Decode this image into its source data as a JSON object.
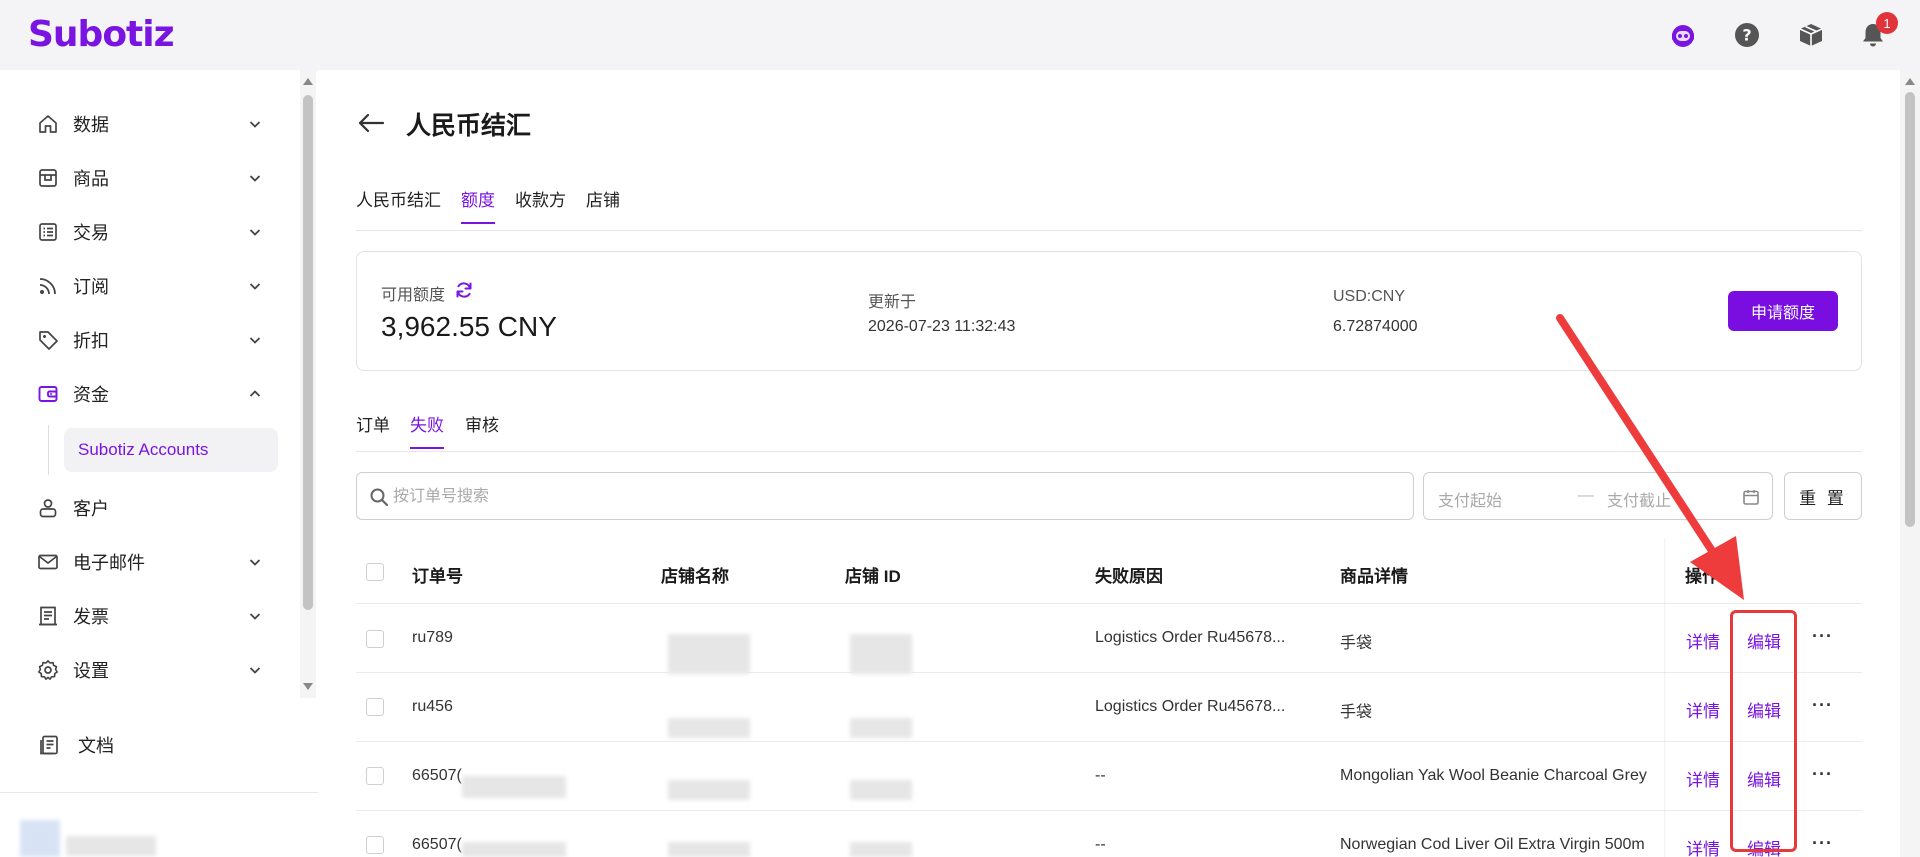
{
  "app": {
    "logo": "Subotiz",
    "notification_count": "1"
  },
  "colors": {
    "accent": "#7a14e0",
    "highlight": "#e5393a"
  },
  "sidebar": {
    "items": [
      {
        "label": "数据",
        "icon": "home-icon",
        "expanded": false
      },
      {
        "label": "商品",
        "icon": "box-icon",
        "expanded": false
      },
      {
        "label": "交易",
        "icon": "list-icon",
        "expanded": false
      },
      {
        "label": "订阅",
        "icon": "rss-icon",
        "expanded": false
      },
      {
        "label": "折扣",
        "icon": "tag-icon",
        "expanded": false
      },
      {
        "label": "资金",
        "icon": "wallet-icon",
        "expanded": true
      },
      {
        "label": "客户",
        "icon": "user-icon",
        "expanded": false
      },
      {
        "label": "电子邮件",
        "icon": "mail-icon",
        "expanded": false
      },
      {
        "label": "发票",
        "icon": "invoice-icon",
        "expanded": false
      },
      {
        "label": "设置",
        "icon": "gear-icon",
        "expanded": false
      }
    ],
    "sub_item": "Subotiz Accounts",
    "docs": "文档"
  },
  "page": {
    "title": "人民币结汇",
    "tabs": [
      "人民币结汇",
      "额度",
      "收款方",
      "店铺"
    ],
    "active_tab": "额度"
  },
  "quota": {
    "available_label": "可用额度",
    "available_value": "3,962.55 CNY",
    "updated_label": "更新于",
    "updated_value": "2026-07-23 11:32:43",
    "rate_label": "USD:CNY",
    "rate_value": "6.72874000",
    "apply_button": "申请额度"
  },
  "subtabs": {
    "items": [
      "订单",
      "失败",
      "审核"
    ],
    "active": "失败"
  },
  "filters": {
    "search_placeholder": "按订单号搜索",
    "date_start_placeholder": "支付起始",
    "date_sep": "—",
    "date_end_placeholder": "支付截止",
    "reset_button": "重 置"
  },
  "table": {
    "headers": [
      "订单号",
      "店铺名称",
      "店铺 ID",
      "失败原因",
      "商品详情",
      "操作"
    ],
    "rows": [
      {
        "order": "ru789",
        "reason": "Logistics Order Ru45678...",
        "product": "手袋"
      },
      {
        "order": "ru456",
        "reason": "Logistics Order Ru45678...",
        "product": "手袋"
      },
      {
        "order": "66507(",
        "reason": "--",
        "product": "Mongolian Yak Wool Beanie Charcoal Grey"
      },
      {
        "order": "66507(",
        "reason": "--",
        "product": "Norwegian Cod Liver Oil Extra Virgin 500m"
      }
    ],
    "actions": {
      "detail": "详情",
      "edit": "编辑",
      "more": "···"
    }
  }
}
